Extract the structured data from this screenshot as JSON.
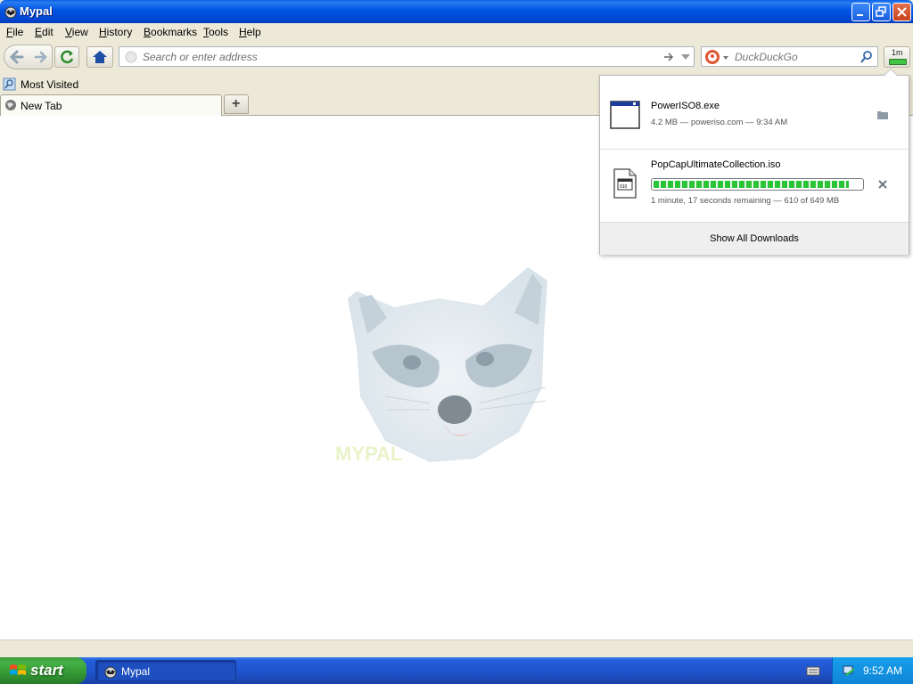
{
  "window": {
    "title": "Mypal"
  },
  "menu": [
    {
      "label": "File",
      "key": "F",
      "rest": "ile"
    },
    {
      "label": "Edit",
      "key": "E",
      "rest": "dit"
    },
    {
      "label": "View",
      "key": "V",
      "rest": "iew"
    },
    {
      "label": "History",
      "key": "H",
      "rest": "istory"
    },
    {
      "label": "Bookmarks",
      "key": "B",
      "rest": "ookmarks"
    },
    {
      "label": "Tools",
      "key": "T",
      "rest": "ools"
    },
    {
      "label": "Help",
      "key": "H",
      "rest": "elp"
    }
  ],
  "address": {
    "placeholder": "Search or enter address",
    "value": ""
  },
  "search": {
    "placeholder": "DuckDuckGo",
    "value": ""
  },
  "downloads_button": {
    "label": "1m"
  },
  "bookmarks": {
    "items": [
      {
        "label": "Most Visited"
      }
    ]
  },
  "tabs": [
    {
      "label": "New Tab",
      "active": true
    }
  ],
  "new_tab_button": {
    "label": "+"
  },
  "downloads_panel": {
    "items": [
      {
        "name": "PowerISO8.exe",
        "status": "4.2 MB — poweriso.com — 9:34 AM",
        "state": "completed"
      },
      {
        "name": "PopCapUltimateCollection.iso",
        "status": "1 minute, 17 seconds remaining — 610 of 649 MB",
        "state": "downloading",
        "progress": 0.94
      }
    ],
    "show_all_label": "Show All Downloads"
  },
  "content": {
    "logo_text": "MYPAL"
  },
  "taskbar": {
    "start_label": "start",
    "items": [
      {
        "label": "Mypal",
        "active": true
      }
    ],
    "clock": "9:52 AM"
  },
  "colors": {
    "titlebar": "#0054e3",
    "progress_fill": "#2bc436",
    "taskbar": "#245edb",
    "start_button": "#3c9c3c"
  }
}
